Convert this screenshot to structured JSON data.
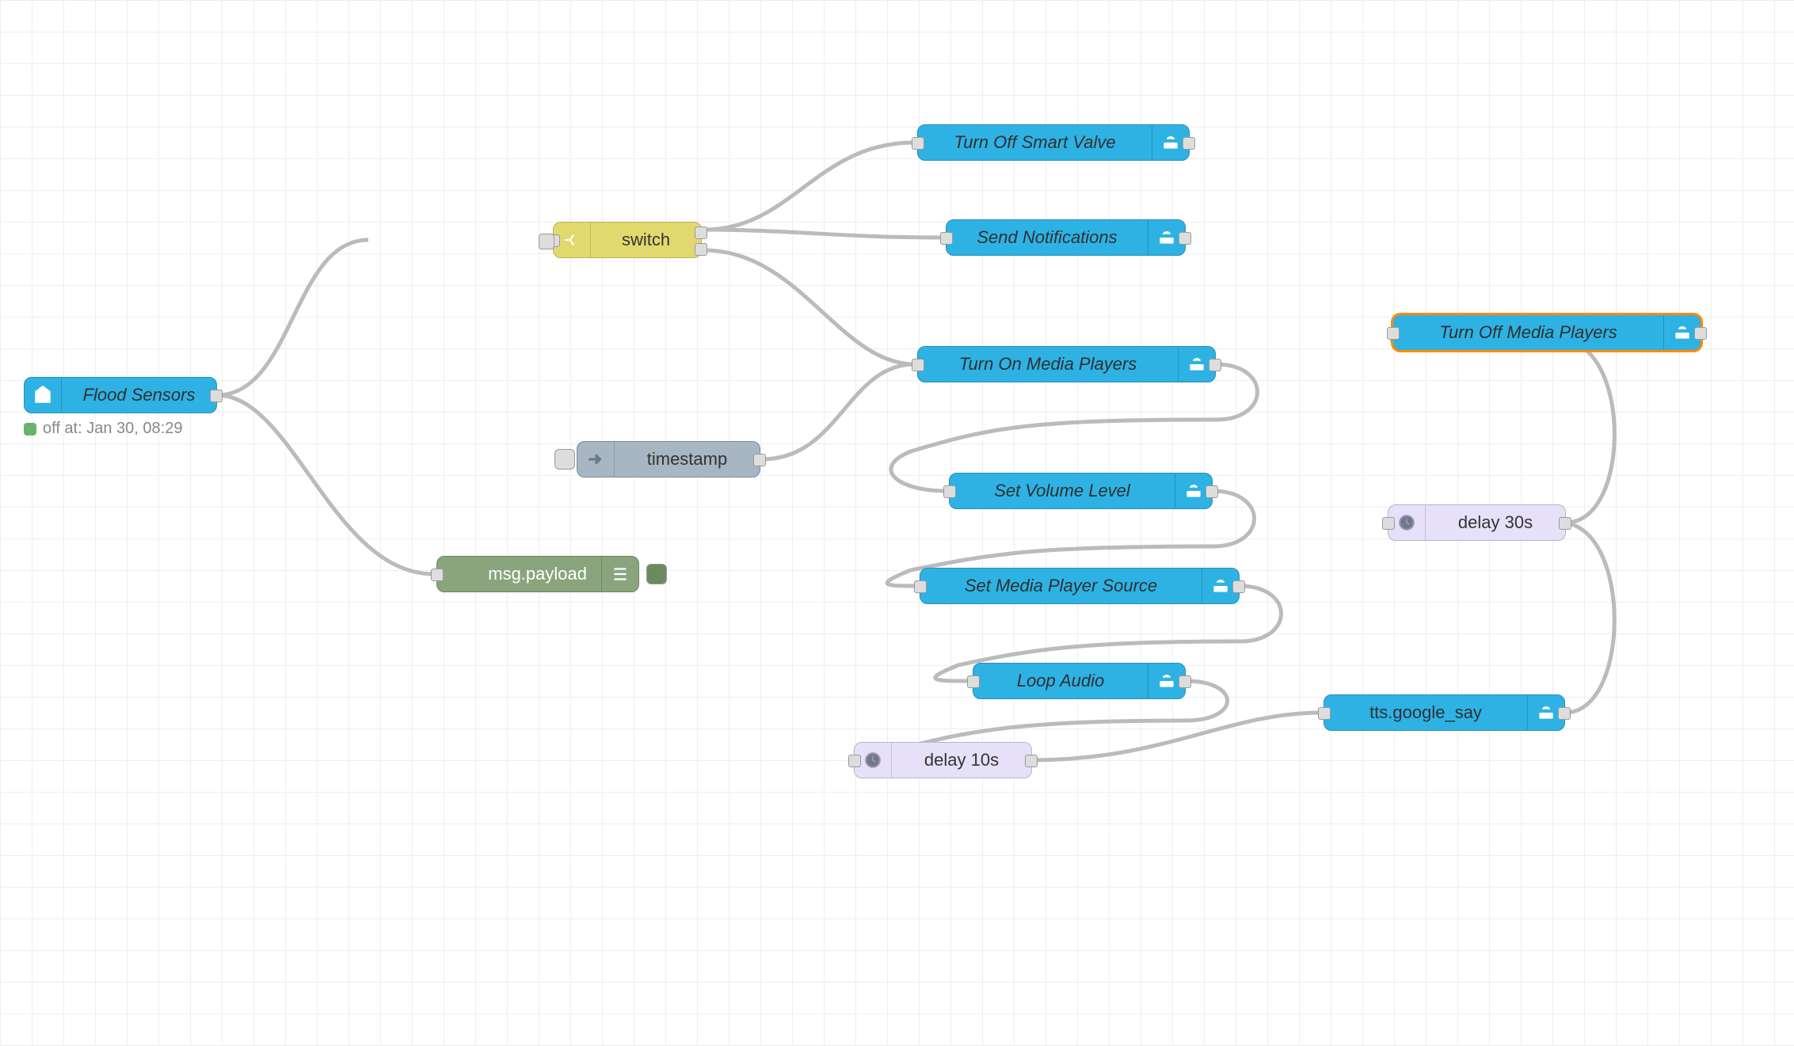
{
  "nodes": {
    "flood_sensors": {
      "label": "Flood Sensors",
      "status": "off at: Jan 30, 08:29"
    },
    "switch": {
      "label": "switch"
    },
    "timestamp": {
      "label": "timestamp"
    },
    "debug": {
      "label": "msg.payload"
    },
    "turn_off_valve": {
      "label": "Turn Off Smart Valve"
    },
    "send_notifications": {
      "label": "Send Notifications"
    },
    "turn_on_media": {
      "label": "Turn On Media Players"
    },
    "set_volume": {
      "label": "Set Volume Level"
    },
    "set_media_source": {
      "label": "Set Media Player Source"
    },
    "loop_audio": {
      "label": "Loop Audio"
    },
    "delay_10s": {
      "label": "delay 10s"
    },
    "tts_google_say": {
      "label": "tts.google_say"
    },
    "delay_30s": {
      "label": "delay 30s"
    },
    "turn_off_media": {
      "label": "Turn Off Media Players"
    }
  }
}
